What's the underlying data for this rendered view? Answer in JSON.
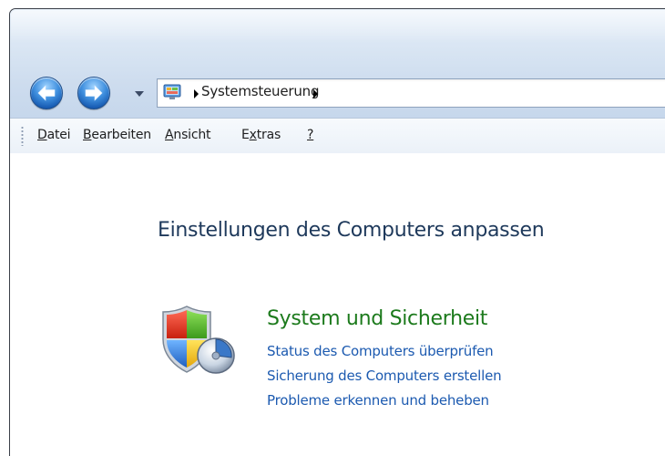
{
  "navigation": {
    "back_label": "Zurück",
    "forward_label": "Vorwärts"
  },
  "address": {
    "path": "Systemsteuerung"
  },
  "menu": {
    "items": [
      {
        "prefix": "",
        "accel": "D",
        "rest": "atei"
      },
      {
        "prefix": "",
        "accel": "B",
        "rest": "earbeiten"
      },
      {
        "prefix": "",
        "accel": "A",
        "rest": "nsicht"
      },
      {
        "prefix": "E",
        "accel": "x",
        "rest": "tras"
      },
      {
        "prefix": "",
        "accel": "?",
        "rest": ""
      }
    ]
  },
  "main": {
    "title": "Einstellungen des Computers anpassen",
    "category": {
      "title": "System und Sicherheit",
      "icon": "shield-security-icon",
      "links": [
        "Status des Computers überprüfen",
        "Sicherung des Computers erstellen",
        "Probleme erkennen und beheben"
      ]
    }
  },
  "colors": {
    "title_blue": "#1e395b",
    "category_green": "#1c7a1c",
    "link_blue": "#1c5ab0",
    "chrome_blue": "#cddcee"
  }
}
